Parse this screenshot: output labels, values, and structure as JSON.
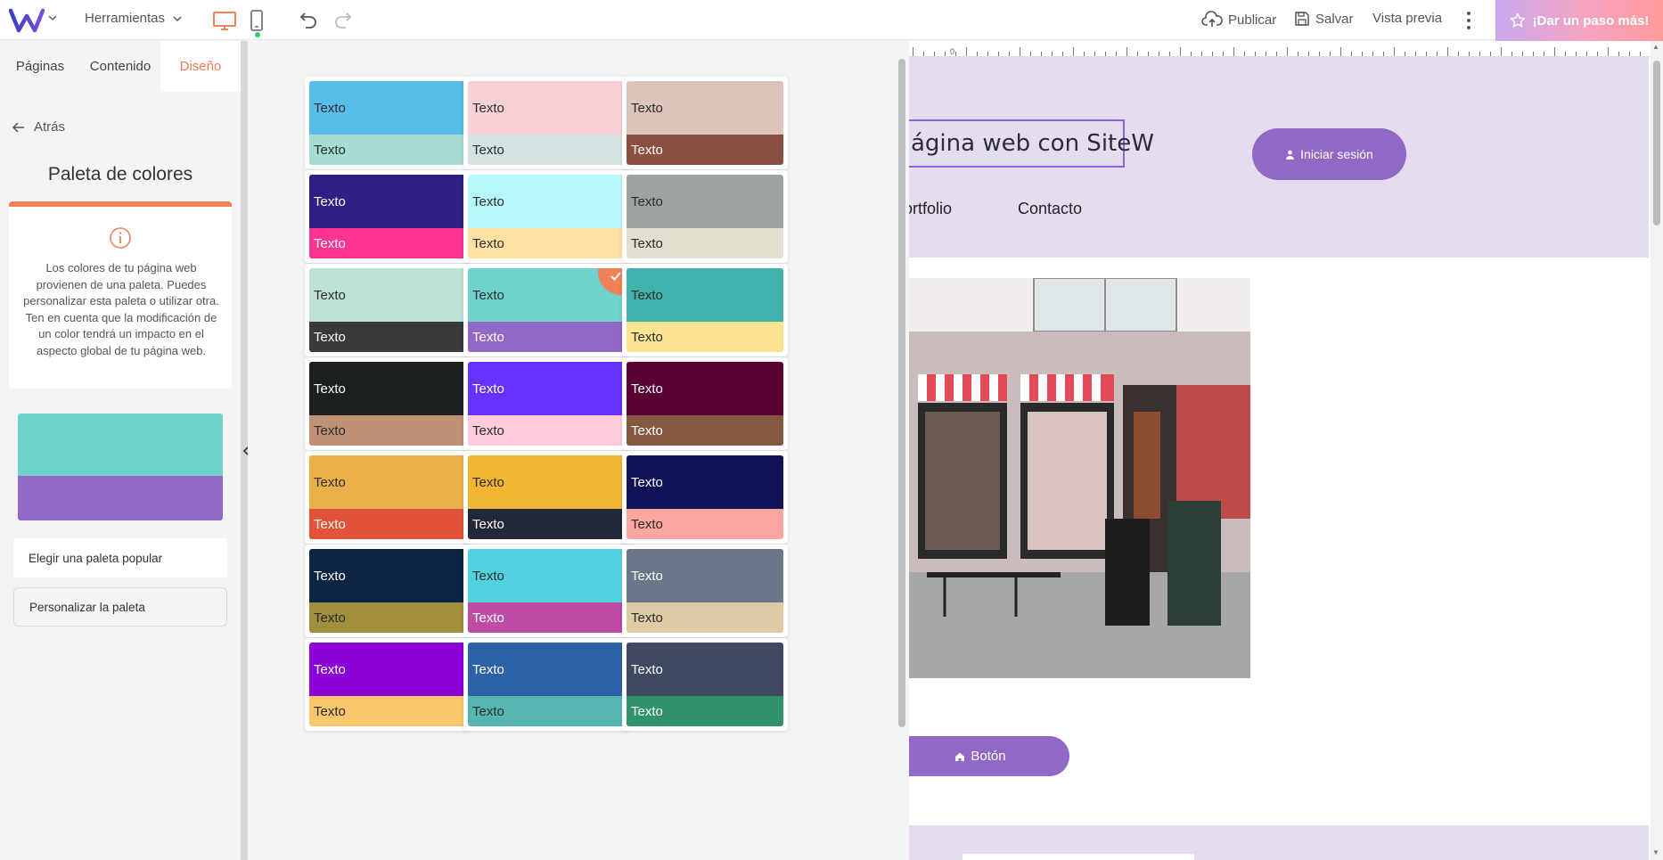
{
  "topbar": {
    "tools_label": "Herramientas",
    "publish_label": "Publicar",
    "save_label": "Salvar",
    "preview_label": "Vista previa",
    "upgrade_label": "¡Dar un paso más!"
  },
  "sidebar": {
    "tabs": [
      {
        "label": "Páginas"
      },
      {
        "label": "Contenido"
      },
      {
        "label": "Diseño"
      }
    ],
    "back_label": "Atrás",
    "title": "Paleta de colores",
    "info_text": "Los colores de tu página web provienen de una paleta. Puedes personalizar esta paleta o utilizar otra. Ten en cuenta que la modificación de un color tendrá un impacto en el aspecto global de tu página web.",
    "current_palette": {
      "primary": "#6fd2cb",
      "secondary": "#9268c6"
    },
    "popular_btn": "Elegir una paleta popular",
    "custom_btn": "Personalizar la paleta"
  },
  "palettes": [
    {
      "label": "Texto",
      "top": "#58bde9",
      "top_text": "#2c2c2c",
      "bottom": "#a6ddd3",
      "bottom_text": "#2c2c2c"
    },
    {
      "label": "Texto",
      "top": "#f8d1d7",
      "top_text": "#2c2c2c",
      "bottom": "#d3e3e3",
      "bottom_text": "#2c2c2c"
    },
    {
      "label": "Texto",
      "top": "#dcc4bb",
      "top_text": "#2c2c2c",
      "bottom": "#8a4f40",
      "bottom_text": "#ffffff"
    },
    {
      "label": "Texto",
      "top": "#2f2085",
      "top_text": "#ffffff",
      "bottom": "#ff3491",
      "bottom_text": "#ffffff"
    },
    {
      "label": "Texto",
      "top": "#b6f9fb",
      "top_text": "#2c2c2c",
      "bottom": "#fde0a4",
      "bottom_text": "#2c2c2c"
    },
    {
      "label": "Texto",
      "top": "#9da49f",
      "top_text": "#2c2c2c",
      "bottom": "#e2dfcf",
      "bottom_text": "#2c2c2c"
    },
    {
      "label": "Texto",
      "top": "#bee0d7",
      "top_text": "#2c2c2c",
      "bottom": "#3a3a38",
      "bottom_text": "#ffffff"
    },
    {
      "label": "Texto",
      "top": "#6fd2cb",
      "top_text": "#2c2c2c",
      "bottom": "#9268c6",
      "bottom_text": "#ffffff",
      "selected": true
    },
    {
      "label": "Texto",
      "top": "#41b1ab",
      "top_text": "#2c2c2c",
      "bottom": "#fbe48f",
      "bottom_text": "#2c2c2c"
    },
    {
      "label": "Texto",
      "top": "#1d2021",
      "top_text": "#ffffff",
      "bottom": "#bf9177",
      "bottom_text": "#2c2c2c"
    },
    {
      "label": "Texto",
      "top": "#6633fc",
      "top_text": "#ffffff",
      "bottom": "#fdcbd9",
      "bottom_text": "#2c2c2c"
    },
    {
      "label": "Texto",
      "top": "#5a0232",
      "top_text": "#ffffff",
      "bottom": "#84593f",
      "bottom_text": "#ffffff"
    },
    {
      "label": "Texto",
      "top": "#e9b049",
      "top_text": "#2c2c2c",
      "bottom": "#e15238",
      "bottom_text": "#ffffff"
    },
    {
      "label": "Texto",
      "top": "#f2b532",
      "top_text": "#2c2c2c",
      "bottom": "#22283a",
      "bottom_text": "#ffffff"
    },
    {
      "label": "Texto",
      "top": "#111158",
      "top_text": "#ffffff",
      "bottom": "#fba5a0",
      "bottom_text": "#2c2c2c"
    },
    {
      "label": "Texto",
      "top": "#0d2544",
      "top_text": "#ffffff",
      "bottom": "#a18f3e",
      "bottom_text": "#2c2c2c"
    },
    {
      "label": "Texto",
      "top": "#52d1de",
      "top_text": "#2c2c2c",
      "bottom": "#be4ba5",
      "bottom_text": "#ffffff"
    },
    {
      "label": "Texto",
      "top": "#6a7789",
      "top_text": "#ffffff",
      "bottom": "#dfcaa6",
      "bottom_text": "#2c2c2c"
    },
    {
      "label": "Texto",
      "top": "#8c02d7",
      "top_text": "#ffffff",
      "bottom": "#fbc66c",
      "bottom_text": "#2c2c2c"
    },
    {
      "label": "Texto",
      "top": "#2d62a6",
      "top_text": "#ffffff",
      "bottom": "#55b6b1",
      "bottom_text": "#2c2c2c"
    },
    {
      "label": "Texto",
      "top": "#404864",
      "top_text": "#ffffff",
      "bottom": "#30936b",
      "bottom_text": "#ffffff"
    }
  ],
  "preview": {
    "site_title": "ágina web con SiteW",
    "login_btn": "Iniciar sesión",
    "nav": [
      "ortfolio",
      "Contacto"
    ],
    "cta": "Botón",
    "ruler_zero": "0",
    "accent": "#9268c6",
    "header_bg": "#e5dcf0"
  },
  "colors": {
    "brand": "#4b3fd6",
    "active_tab": "#ef7b55",
    "accent_orange": "#f08159"
  }
}
